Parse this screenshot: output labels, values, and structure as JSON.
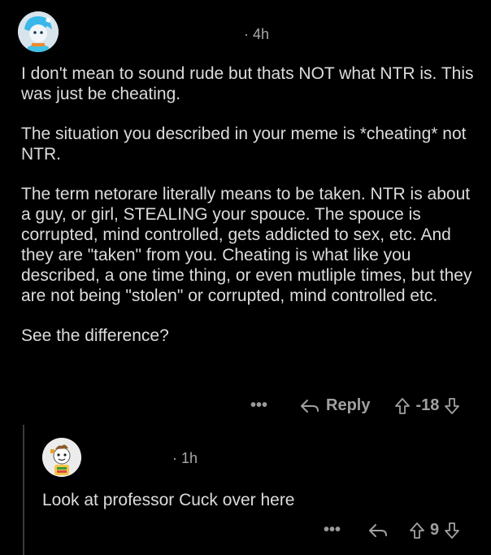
{
  "parent": {
    "meta": "· 4h",
    "paragraphs": [
      "I don't mean to sound rude but thats NOT what NTR is. This was just be cheating.",
      "The situation you described in your meme is *cheating* not NTR.",
      "The term netorare literally means to be taken. NTR is about a guy, or girl, STEALING your spouce. The spouce is corrupted, mind controlled, gets addicted to sex, etc. And they are \"taken\" from you. Cheating is what like you described, a one time thing, or even mutliple times, but they are not being \"stolen\" or corrupted, mind controlled etc.",
      "See the difference?"
    ],
    "actions": {
      "more": "•••",
      "reply_label": "Reply",
      "score": "-18"
    }
  },
  "reply": {
    "meta": "· 1h",
    "text": "Look at professor Cuck over here",
    "actions": {
      "more": "•••",
      "score": "9"
    }
  },
  "colors": {
    "background": "#000000",
    "text": "#dcdcdc",
    "muted": "#9a9a9a",
    "thread_line": "#3a3a3a"
  }
}
